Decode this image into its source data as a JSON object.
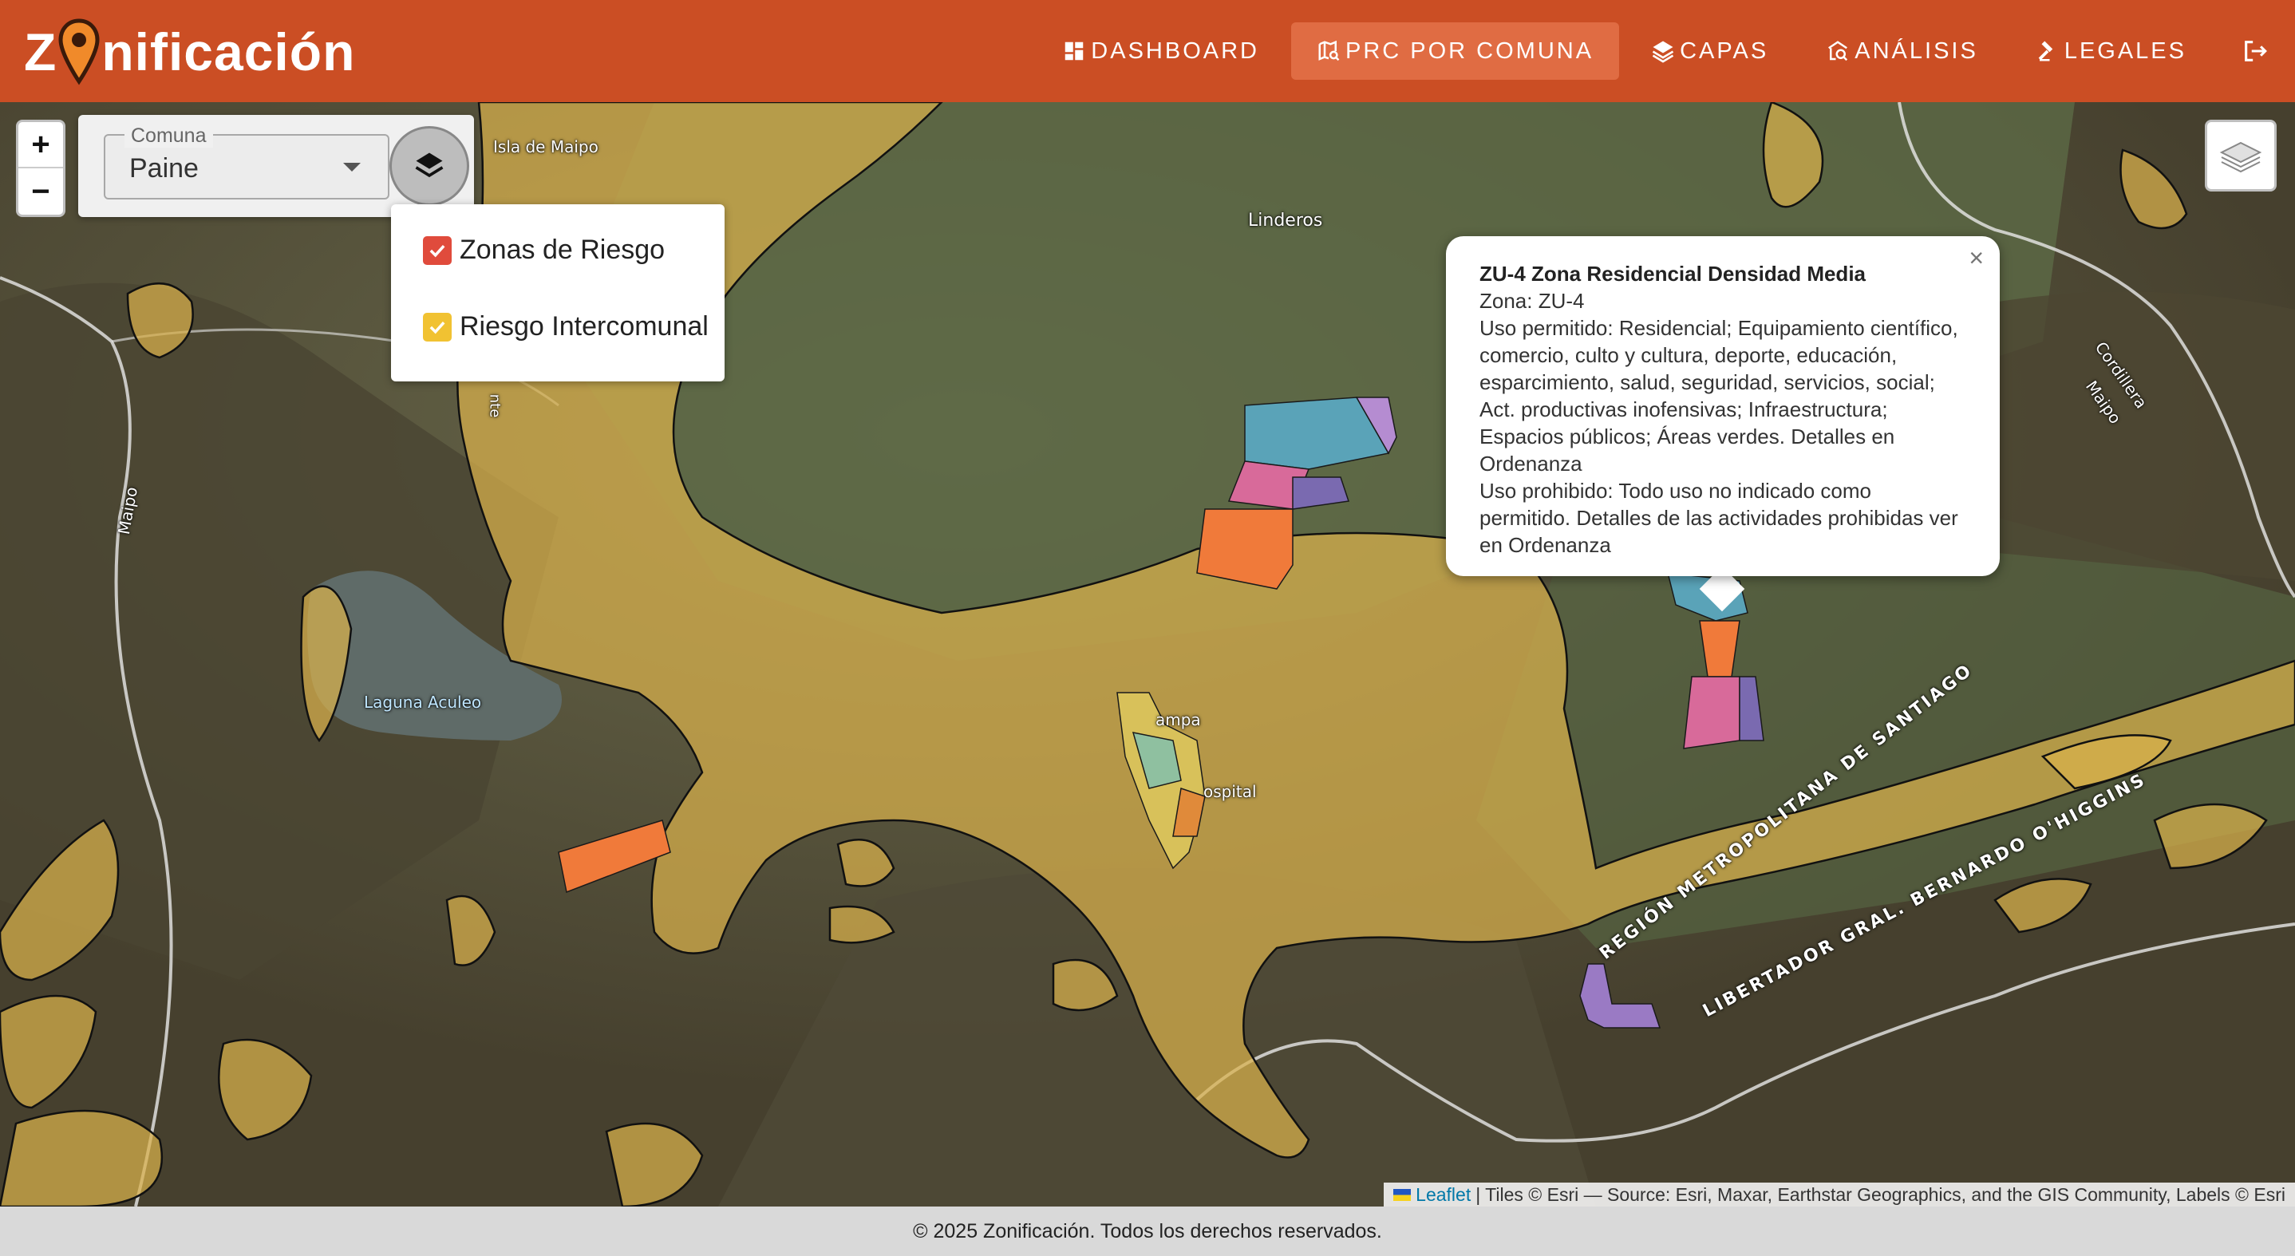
{
  "app": {
    "logo_pre": "Z",
    "logo_post": "nificación"
  },
  "nav": {
    "items": [
      {
        "label": "DASHBOARD",
        "icon": "dashboard-icon"
      },
      {
        "label": "PRC POR COMUNA",
        "icon": "map-search-icon",
        "active": true
      },
      {
        "label": "CAPAS",
        "icon": "layers-icon"
      },
      {
        "label": "ANÁLISIS",
        "icon": "analysis-icon"
      },
      {
        "label": "LEGALES",
        "icon": "gavel-icon"
      }
    ],
    "logout_icon": "logout-icon"
  },
  "controls": {
    "zoom_in": "+",
    "zoom_out": "−",
    "comuna_label": "Comuna",
    "comuna_value": "Paine"
  },
  "layers": [
    {
      "label": "Zonas de Riesgo",
      "checked": true,
      "color": "#e04b3c"
    },
    {
      "label": "Riesgo Intercomunal",
      "checked": true,
      "color": "#f1c232"
    }
  ],
  "map_labels": {
    "isla_de_maipo": "Isla de Maipo",
    "linderos": "Linderos",
    "laguna_aculeo": "Laguna Aculeo",
    "paine_partial": "ampa",
    "hospital_partial": "ospital",
    "maipo_left": "Maipo",
    "cordillera_maipo_1": "Cordillera",
    "cordillera_maipo_2": "Maipo",
    "region_1": "REGIÓN METROPOLITANA DE SANTIAGO",
    "region_2": "LIBERTADOR GRAL. BERNARDO O'HIGGINS",
    "partial_left": "nte"
  },
  "popup": {
    "title": "ZU-4 Zona Residencial Densidad Media",
    "zona": "Zona: ZU-4",
    "uso_permitido": "Uso permitido: Residencial; Equipamiento científico, comercio, culto y cultura, deporte, educación, esparcimiento, salud, seguridad, servicios, social; Act. productivas inofensivas; Infraestructura; Espacios públicos; Áreas verdes. Detalles en Ordenanza",
    "uso_prohibido": "Uso prohibido: Todo uso no indicado como permitido. Detalles de las actividades prohibidas ver en Ordenanza",
    "close": "×"
  },
  "attribution": {
    "leaflet": "Leaflet",
    "rest": "| Tiles © Esri — Source: Esri, Maxar, Earthstar Geographics, and the GIS Community, Labels © Esri"
  },
  "footer": "© 2025 Zonificación. Todos los derechos reservados.",
  "colors": {
    "header": "#cb4e24",
    "nav_active": "#e06c43",
    "risk_zone": "#d9b24c",
    "urban_orange": "#f07a3a"
  }
}
